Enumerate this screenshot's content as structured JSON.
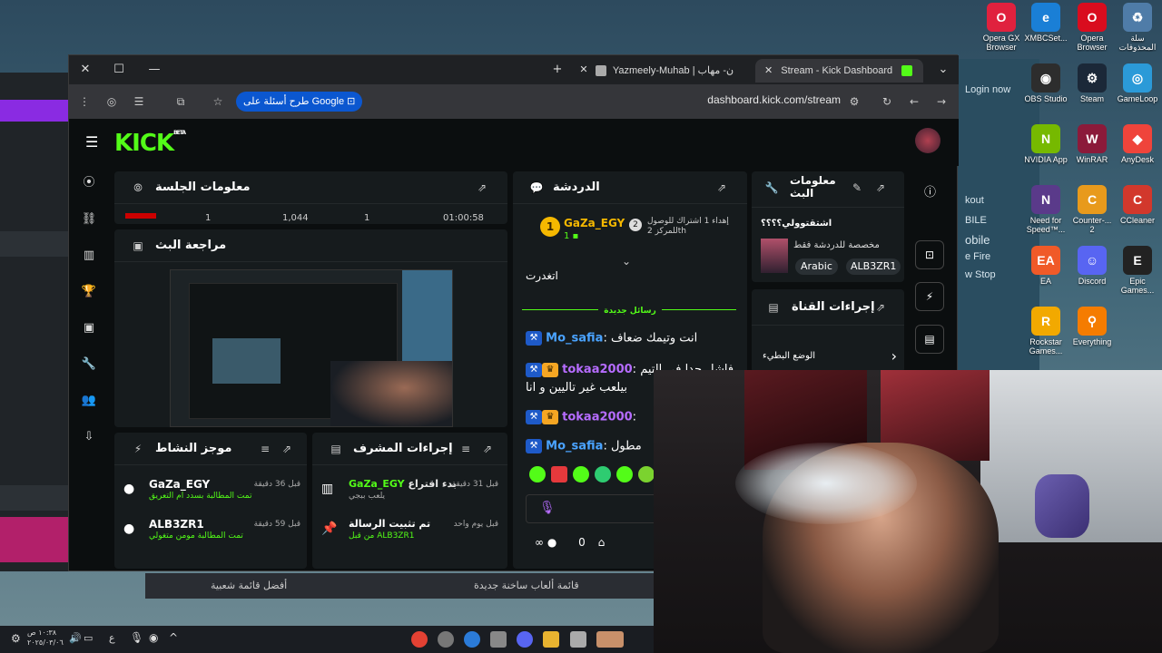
{
  "desktop": {
    "icons": [
      {
        "label": "Opera GX Browser",
        "color": "#e0213e",
        "glyph": "O"
      },
      {
        "label": "XMBCSet...",
        "color": "#1a7fd6",
        "glyph": "e"
      },
      {
        "label": "Opera Browser",
        "color": "#d90c1e",
        "glyph": "O"
      },
      {
        "label": "سلة المحذوفات",
        "color": "#4f7ca8",
        "glyph": "♻"
      },
      {
        "label": "OBS Studio",
        "color": "#2d2d2d",
        "glyph": "◉"
      },
      {
        "label": "Steam",
        "color": "#1b2838",
        "glyph": "⚙"
      },
      {
        "label": "GameLoop",
        "color": "#2b9ad8",
        "glyph": "◎"
      },
      {
        "label": "NVIDIA App",
        "color": "#76b900",
        "glyph": "N"
      },
      {
        "label": "WinRAR",
        "color": "#8b1a3a",
        "glyph": "W"
      },
      {
        "label": "AnyDesk",
        "color": "#ef443b",
        "glyph": "◆"
      },
      {
        "label": "Need for Speed™...",
        "color": "#5a3a8a",
        "glyph": "N"
      },
      {
        "label": "Counter-... 2",
        "color": "#e89a1c",
        "glyph": "C"
      },
      {
        "label": "CCleaner",
        "color": "#d2382c",
        "glyph": "C"
      },
      {
        "label": "EA",
        "color": "#f05a28",
        "glyph": "EA"
      },
      {
        "label": "Discord",
        "color": "#5865f2",
        "glyph": "☺"
      },
      {
        "label": "Epic Games...",
        "color": "#222222",
        "glyph": "E"
      },
      {
        "label": "Rockstar Games...",
        "color": "#f2a900",
        "glyph": "R"
      },
      {
        "label": "Everything",
        "color": "#f57c00",
        "glyph": "⚲"
      }
    ],
    "right_game_lines": [
      "Login now",
      "kout",
      "BILE",
      "obile",
      "e Fire",
      "w Stop"
    ]
  },
  "browser": {
    "tabs": [
      {
        "label": "Stream - Kick Dashboard",
        "active": true
      },
      {
        "label": "Yazmeely-Muhab | ن- مهاب",
        "active": false
      }
    ],
    "google_pill": "طرح أسئلة على Google",
    "url": "dashboard.kick.com/stream"
  },
  "kick": {
    "logo": "KICK",
    "logo_beta": "BETA",
    "session_panel": {
      "title": "معلومات الجلسة",
      "stats": [
        "1",
        "1,044",
        "1",
        "01:00:58"
      ]
    },
    "review_panel": {
      "title": "مراجعة البث"
    },
    "chat_panel": {
      "title": "الدردشة",
      "pinned_user": "GaZa_EGY",
      "pinned_count": "1",
      "gift_text": "إهداء 1 اشتراك للوصول للمركز 2th",
      "partial_line": "اتغدرت",
      "new_messages_label": "رسائل جديدة",
      "messages": [
        {
          "user": "Mo_safia",
          "user_color": "blue",
          "text": "انت وتيمك ضعاف"
        },
        {
          "user": "tokaa2000",
          "user_color": "purple",
          "text": "فاشل جدا في التيم بيلعب غير تاليين و انا"
        },
        {
          "user": "tokaa2000",
          "user_color": "purple",
          "text": ""
        },
        {
          "user": "Mo_safia",
          "user_color": "blue",
          "text": "مطول"
        }
      ],
      "input_placeholder": "ل",
      "footer_count": "0"
    },
    "stream_info_panel": {
      "title": "معلومات البث",
      "stream_title": "اشتقتوولي؟؟؟؟",
      "subtitle": "مخصصة للدردشة فقط",
      "tags": [
        "Arabic",
        "ALB3ZR1"
      ]
    },
    "channel_actions_panel": {
      "title": "إجراءات القناة",
      "item": "الوضع البطيء"
    },
    "activity_panel": {
      "title": "موجز النشاط",
      "items": [
        {
          "user": "GaZa_EGY",
          "time": "قبل 36 دقيقة",
          "detail": "تمت المطالبة بسدد ام التعريق"
        },
        {
          "user": "ALB3ZR1",
          "time": "قبل 59 دقيقة",
          "detail": "تمت المطالبة مومن متغولي"
        }
      ]
    },
    "mod_panel": {
      "title": "إجراءات المشرف",
      "items": [
        {
          "user": "GaZa_EGY",
          "action": "بدء اقتراع",
          "time": "قبل 31 دقيقة",
          "detail": "يلعب ببجي"
        },
        {
          "user": "",
          "action": "تم تثبيت الرسالة",
          "time": "قبل يوم واحد",
          "detail": "من قبل ALB3ZR1"
        }
      ]
    }
  },
  "bottom_bar": {
    "left": "أفضل قائمة شعبية",
    "right": "قائمة ألعاب ساخنة جديدة"
  },
  "taskbar": {
    "clock_time": "١٠:٣٨ ص",
    "clock_date": "٢٠٢٥/٠٣/٠٦",
    "lang": "ع"
  }
}
